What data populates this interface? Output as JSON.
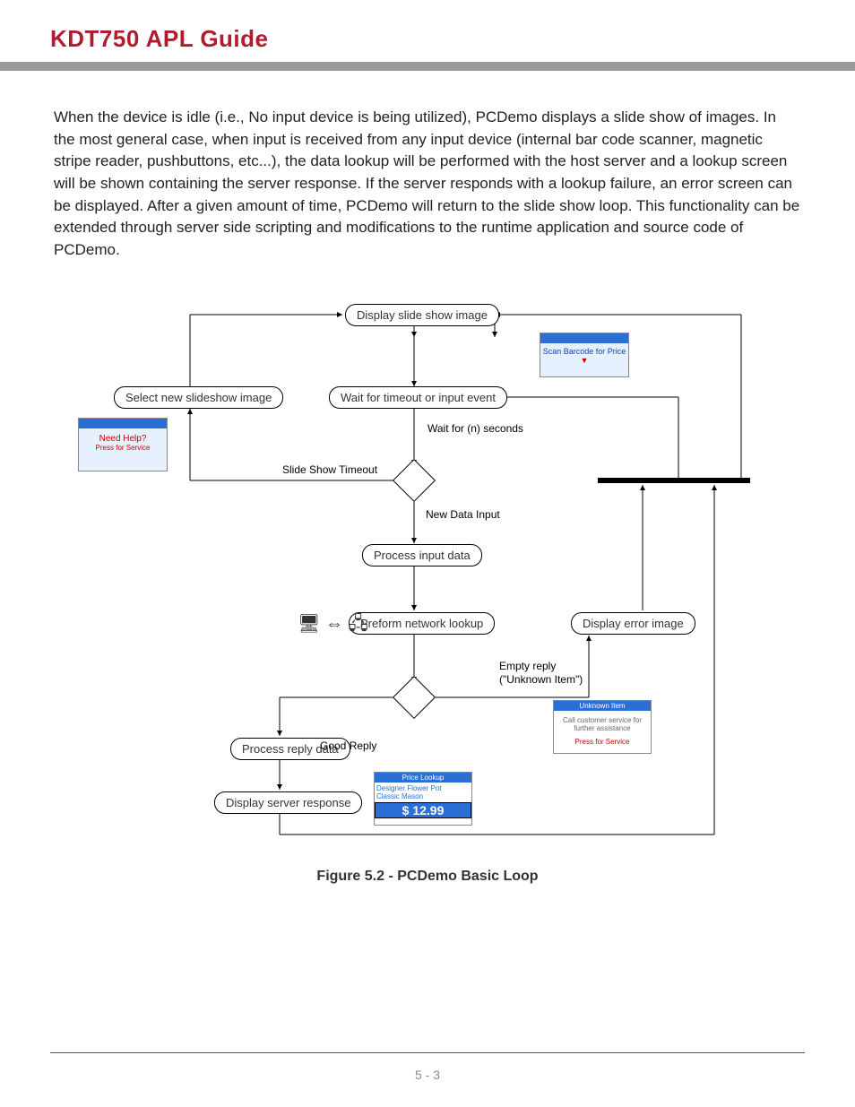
{
  "header": {
    "title": "KDT750 APL Guide"
  },
  "body": {
    "paragraph": "When the device is idle (i.e., No input device is being utilized), PCDemo displays a slide show of images. In the most general case, when input is received from any input device (internal bar code scanner, magnetic stripe reader, pushbuttons, etc...), the data lookup will be performed with the host server and a lookup screen will be shown containing the server response. If the server responds with a lookup failure, an error screen can be displayed. After a given amount of time, PCDemo will return to the slide show loop. This functionality can be extended through server side scripting and modifications to the runtime application and source code of PCDemo."
  },
  "diagram": {
    "nodes": {
      "display_slide": "Display slide show image",
      "select_new": "Select new slideshow image",
      "wait_event": "Wait for timeout or input event",
      "process_input": "Process input data",
      "network_lookup": "Preform network lookup",
      "display_error": "Display error image",
      "process_reply": "Process reply data",
      "display_response": "Display server response"
    },
    "labels": {
      "wait_seconds": "Wait for (n) seconds",
      "slideshow_timeout": "Slide Show Timeout",
      "new_data_input": "New Data Input",
      "good_reply": "Good Reply",
      "empty_reply_line1": "Empty reply",
      "empty_reply_line2": "(\"Unknown Item\")"
    },
    "thumbs": {
      "scan_barcode": "Scan Barcode for Price",
      "need_help": "Need Help?",
      "press_service": "Press for Service",
      "price_lookup": "Price Lookup",
      "price_value": "$ 12.99",
      "unknown_item": "Unknown Item"
    },
    "caption": "Figure 5.2 - PCDemo Basic Loop"
  },
  "footer": {
    "page": "5 - 3"
  }
}
